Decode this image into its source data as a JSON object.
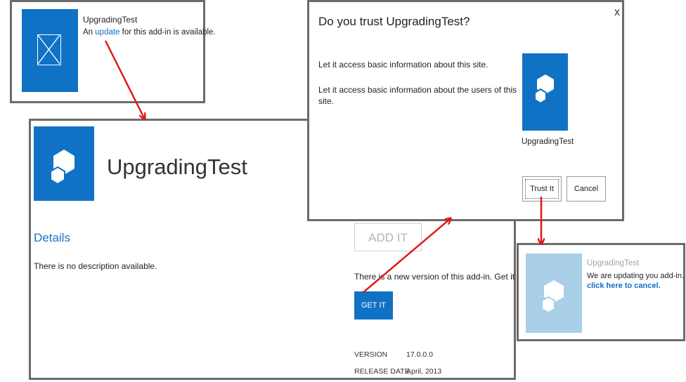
{
  "colors": {
    "accent": "#0f72c5",
    "arrow": "#e0191b",
    "frame": "#6b6b6b",
    "fadedTile": "#a9cfe9"
  },
  "notification": {
    "app_name": "UpgradingTest",
    "line_prefix": "An",
    "update_link": "update",
    "line_suffix": "for this add-in is available."
  },
  "details_page": {
    "app_title": "UpgradingTest",
    "details_heading": "Details",
    "description": "There is no description available.",
    "add_it": "ADD IT",
    "new_version_text": "There is a new version of this add-in. Get it now.",
    "get_it": "GET IT",
    "version_label": "VERSION",
    "version_value": "17.0.0.0",
    "release_label": "RELEASE DATE",
    "release_value": "April, 2013"
  },
  "trust_dialog": {
    "question": "Do you trust UpgradingTest?",
    "close": "x",
    "permission_1": "Let it access basic information about this site.",
    "permission_2_line1": "Let it access basic information about the users of this",
    "permission_2_line2": "site.",
    "app_name": "UpgradingTest",
    "trust_button": "Trust It",
    "cancel_button": "Cancel"
  },
  "updating": {
    "app_name": "UpgradingTest",
    "message": "We are updating you add-in.",
    "cancel_link": "click here to cancel."
  }
}
